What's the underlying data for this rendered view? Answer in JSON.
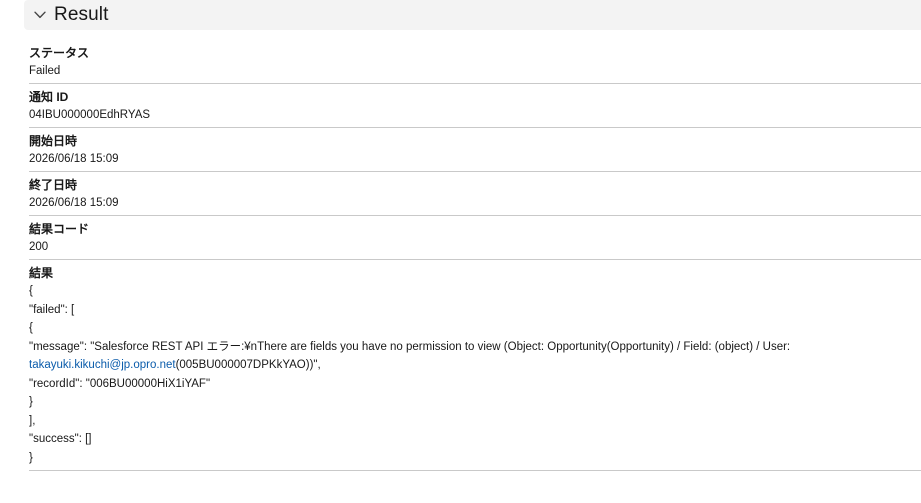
{
  "section": {
    "title": "Result"
  },
  "fields": {
    "status": {
      "label": "ステータス",
      "value": "Failed"
    },
    "notification_id": {
      "label": "通知 ID",
      "value": "04IBU000000EdhRYAS"
    },
    "start_time": {
      "label": "開始日時",
      "value": "2026/06/18 15:09"
    },
    "end_time": {
      "label": "終了日時",
      "value": "2026/06/18 15:09"
    },
    "result_code": {
      "label": "結果コード",
      "value": "200"
    },
    "result": {
      "label": "結果",
      "lines": {
        "l1": "{",
        "l2": "\"failed\": [",
        "l3": "{",
        "l4": "\"message\": \"Salesforce REST API エラー:¥nThere are fields you have no permission to view (Object: Opportunity(Opportunity) / Field: (object) / User:",
        "l5_link": "takayuki.kikuchi@jp.opro.net",
        "l5_rest": "(005BU000007DPKkYAO))\",",
        "l6": "\"recordId\": \"006BU00000HiX1iYAF\"",
        "l7": "}",
        "l8": "],",
        "l9": "\"success\": []",
        "l10": "}"
      }
    }
  }
}
